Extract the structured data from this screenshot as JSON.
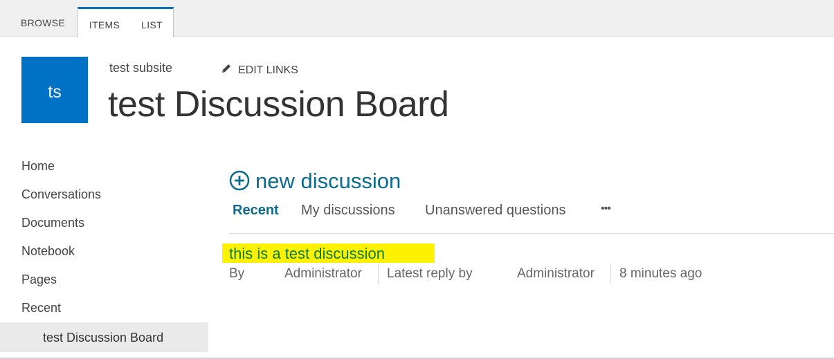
{
  "ribbon": {
    "tabs": [
      {
        "label": "BROWSE"
      },
      {
        "label": "ITEMS"
      },
      {
        "label": "LIST"
      }
    ],
    "active_tab": "ITEMS",
    "accent_color": "#0072c6"
  },
  "header": {
    "logo_text": "ts",
    "logo_color": "#0072c6",
    "subsite_name": "test subsite",
    "edit_links_label": "EDIT LINKS",
    "edit_links_icon": "pencil-icon",
    "page_title": "test Discussion Board"
  },
  "leftnav": {
    "items": [
      {
        "label": "Home"
      },
      {
        "label": "Conversations"
      },
      {
        "label": "Documents"
      },
      {
        "label": "Notebook"
      },
      {
        "label": "Pages"
      },
      {
        "label": "Recent"
      },
      {
        "label": "test Discussion Board"
      }
    ],
    "selected": "test Discussion Board"
  },
  "main": {
    "new_discussion_label": "new discussion",
    "new_discussion_icon": "plus-circle-icon",
    "filters": [
      {
        "label": "Recent"
      },
      {
        "label": "My discussions"
      },
      {
        "label": "Unanswered questions"
      },
      {
        "label": "•••"
      }
    ],
    "active_filter": "Recent",
    "discussions": [
      {
        "title": "this is a test discussion",
        "by_label": "By",
        "author": "Administrator",
        "latest_reply_label": "Latest reply by",
        "latest_reply_author": "Administrator",
        "time": "8 minutes ago"
      }
    ],
    "highlight_color": "#fff200",
    "link_color": "#0b6a8c"
  }
}
